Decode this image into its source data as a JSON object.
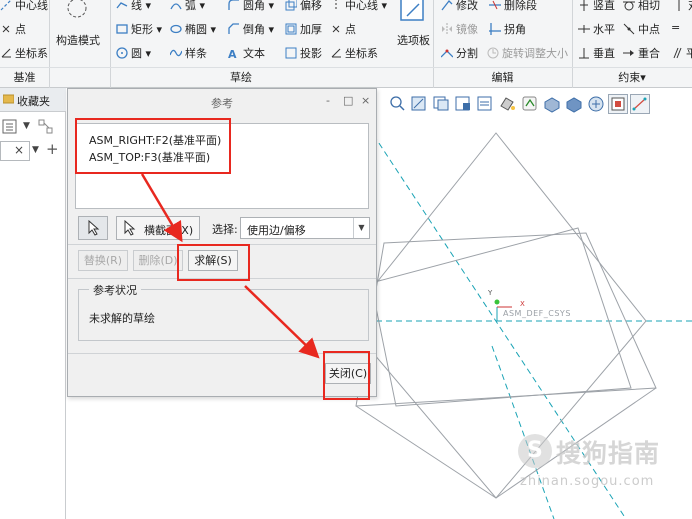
{
  "ribbon": {
    "row1": {
      "centerline_left": "中心线",
      "line": "线",
      "arc": "弧",
      "fillet": "圆角",
      "offset": "偏移",
      "centerline_right": "中心线",
      "modify": "修改",
      "delete_segment": "删除段",
      "vertical_top": "竖直",
      "tangent": "相切",
      "symmetric_cut": "对"
    },
    "row2": {
      "point_left": "点",
      "rectangle": "矩形",
      "ellipse": "椭圆",
      "chamfer": "倒角",
      "thicken": "加厚",
      "point": "点",
      "mirror": "镜像",
      "corner": "拐角",
      "horizontal": "水平",
      "midpoint": "中点",
      "equal_mark": "=",
      "construction_mode": "构造模式",
      "palette": "选项板"
    },
    "row3": {
      "coord_left": "坐标系",
      "circle": "圆",
      "spline": "样条",
      "text": "文本",
      "project": "投影",
      "coord": "坐标系",
      "divide": "分割",
      "rotate_resize": "旋转调整大小",
      "perpendicular": "垂直",
      "coincident": "重合",
      "parallel_cut": "平"
    },
    "groups": {
      "datum": "基准",
      "sketching": "草绘",
      "editing": "编辑",
      "constrain": "约束▾"
    }
  },
  "left_panel": {
    "favorites_tab": "收藏夹",
    "close_x": "×",
    "add": "+"
  },
  "dialog": {
    "title": "参考",
    "window_buttons": [
      "-",
      "□",
      "×"
    ],
    "references": [
      "ASM_RIGHT:F2(基准平面)",
      "ASM_TOP:F3(基准平面)"
    ],
    "cross_section_label": "横截面(X)",
    "select_label": "选择:",
    "select_value": "使用边/偏移",
    "replace_button": "替换(R)",
    "delete_button": "删除(D)",
    "solve_button": "求解(S)",
    "status_legend": "参考状况",
    "status_text": "未求解的草绘",
    "close_button": "关闭(C)"
  },
  "canvas": {
    "csys_label": "ASM_DEF_CSYS",
    "csys_x": "X",
    "csys_y": "Y"
  },
  "watermark": {
    "brand": "搜狗指南",
    "url": "zhinan.sogou.com"
  },
  "colors": {
    "annotation_red": "#e8281f",
    "datum_cyan": "#1aa3b5",
    "sketch_gray": "#9da2a8"
  }
}
